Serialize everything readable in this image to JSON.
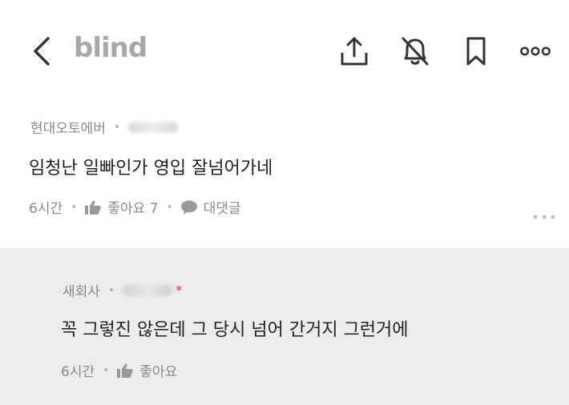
{
  "header": {
    "logo": "blind",
    "icons": [
      "chevron-left-icon",
      "share-icon",
      "bell-off-icon",
      "bookmark-icon",
      "more-icon"
    ]
  },
  "comments": [
    {
      "company": "현대오토에버",
      "author": "",
      "text": "임청난 일빠인가 영입 잘넘어가네",
      "time": "6시간",
      "like_label": "좋아요 7",
      "reply_label": "대댓글"
    },
    {
      "company": "새회사",
      "author": "",
      "author_badge": "*",
      "text": "꼭 그렇진 않은데 그 당시 넘어 간거지 그런거에",
      "time": "6시간",
      "like_label": "좋아요"
    }
  ],
  "colors": {
    "logo": "#a8a8a8",
    "reply_bg": "#ececed",
    "badge": "#dd3333"
  }
}
